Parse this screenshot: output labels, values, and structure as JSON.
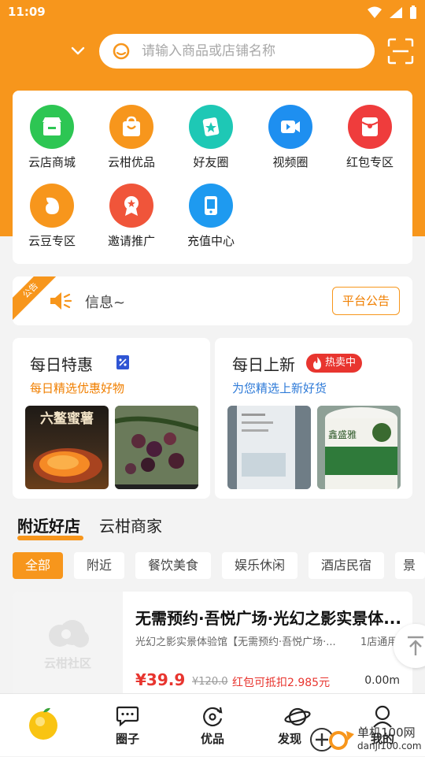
{
  "status": {
    "time": "11:09"
  },
  "search": {
    "placeholder": "请输入商品或店铺名称"
  },
  "grid": [
    {
      "label": "云店商城",
      "icon": "store-icon",
      "color": "#2dc653"
    },
    {
      "label": "云柑优品",
      "icon": "bag-icon",
      "color": "#f7961c"
    },
    {
      "label": "好友圈",
      "icon": "friends-icon",
      "color": "#1ec8b5"
    },
    {
      "label": "视频圈",
      "icon": "video-icon",
      "color": "#1e8ff0"
    },
    {
      "label": "红包专区",
      "icon": "red-packet-icon",
      "color": "#ef3c3c"
    },
    {
      "label": "云豆专区",
      "icon": "bean-icon",
      "color": "#f7961c"
    },
    {
      "label": "邀请推广",
      "icon": "badge-icon",
      "color": "#f0553a"
    },
    {
      "label": "充值中心",
      "icon": "recharge-icon",
      "color": "#1e9af0"
    }
  ],
  "notice": {
    "badge": "公告",
    "text": "信息~",
    "button": "平台公告"
  },
  "promos": [
    {
      "title": "每日特惠",
      "subtitle": "每日精选优惠好物",
      "subtitle_color": "#f07f00",
      "img_text": "六鳌蜜薯"
    },
    {
      "title": "每日上新",
      "subtitle": "为您精选上新好货",
      "subtitle_color": "#2f7bd8",
      "badge": "热卖中",
      "img_text": "鑫盛雅"
    }
  ],
  "tabs": {
    "active": "附近好店",
    "other": "云柑商家"
  },
  "chips": [
    "全部",
    "附近",
    "餐饮美食",
    "娱乐休闲",
    "酒店民宿",
    "景"
  ],
  "store": {
    "name": "无需预约·吾悦广场·光幻之影实景体...",
    "desc": "光幻之影实景体验馆【无需预约·吾悦广场·...",
    "count": "1店通用",
    "price": "¥39.9",
    "old_price": "¥120.0",
    "red": "红包可抵扣2.985元",
    "distance": "0.00m",
    "thumb_text": "云柑社区"
  },
  "nav": [
    {
      "label": "",
      "icon": "orange-home-icon"
    },
    {
      "label": "圈子",
      "icon": "chat-icon"
    },
    {
      "label": "优品",
      "icon": "refresh-icon"
    },
    {
      "label": "发现",
      "icon": "planet-icon"
    },
    {
      "label": "我的",
      "icon": "user-icon"
    }
  ],
  "watermark": {
    "line1": "单机100网",
    "line2": "danji100.com"
  },
  "colors": {
    "accent": "#f7961c",
    "red": "#e8352f"
  }
}
